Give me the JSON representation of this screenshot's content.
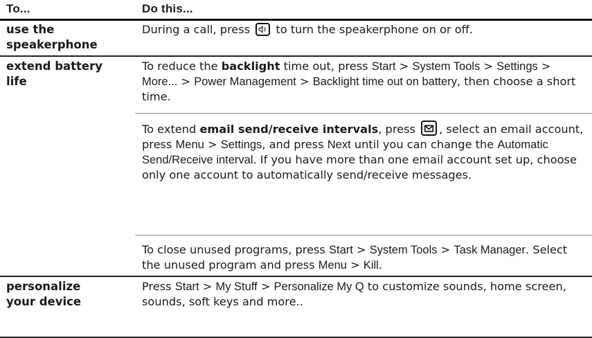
{
  "header": {
    "col1": "To...",
    "col2": "Do this..."
  },
  "rows": [
    {
      "todo": [
        "use the",
        "speakerphone"
      ],
      "paras": [
        [
          {
            "t": "During a call, press "
          },
          {
            "icon": "speakerphone-key-icon"
          },
          {
            "t": " to turn the speakerphone on or off."
          }
        ]
      ]
    },
    {
      "todo": [
        "extend battery",
        "life"
      ],
      "paras": [
        [
          {
            "t": "To reduce the "
          },
          {
            "b": "backlight"
          },
          {
            "t": " time out, press "
          },
          {
            "k": "Start"
          },
          {
            "t": " > "
          },
          {
            "k": "System Tools"
          },
          {
            "t": " > "
          },
          {
            "k": "Settings"
          },
          {
            "t": " > "
          },
          {
            "k": "More..."
          },
          {
            "t": " > "
          },
          {
            "k": "Power Management"
          },
          {
            "t": " > "
          },
          {
            "k": "Backlight time out on battery"
          },
          {
            "t": ", then choose a short time."
          }
        ],
        [
          {
            "t": "To extend "
          },
          {
            "b": "email send/receive intervals"
          },
          {
            "t": ", press "
          },
          {
            "icon": "messaging-key-icon"
          },
          {
            "t": ", select an email account, press "
          },
          {
            "k": "Menu"
          },
          {
            "t": " > "
          },
          {
            "k": "Settings"
          },
          {
            "t": ", and press "
          },
          {
            "k": "Next"
          },
          {
            "t": " until you can change the "
          },
          {
            "k": "Automatic Send/Receive interval"
          },
          {
            "t": ". If you have more than one email account set up, choose only one account to automatically send/receive messages."
          }
        ],
        [
          {
            "t": "To close unused programs, press "
          },
          {
            "k": "Start"
          },
          {
            "t": " > "
          },
          {
            "k": "System Tools"
          },
          {
            "t": " > "
          },
          {
            "k": "Task Manager"
          },
          {
            "t": ". Select the unused program and press "
          },
          {
            "k": "Menu"
          },
          {
            "t": " > "
          },
          {
            "k": "Kill"
          },
          {
            "t": "."
          }
        ]
      ]
    },
    {
      "todo": [
        "personalize",
        "your device"
      ],
      "paras": [
        [
          {
            "t": "Press "
          },
          {
            "k": "Start"
          },
          {
            "t": " > "
          },
          {
            "k": "My Stuff"
          },
          {
            "t": " > "
          },
          {
            "k": "Personalize My Q"
          },
          {
            "t": " to customize sounds, home screen, sounds, soft keys and more.."
          }
        ]
      ]
    }
  ]
}
